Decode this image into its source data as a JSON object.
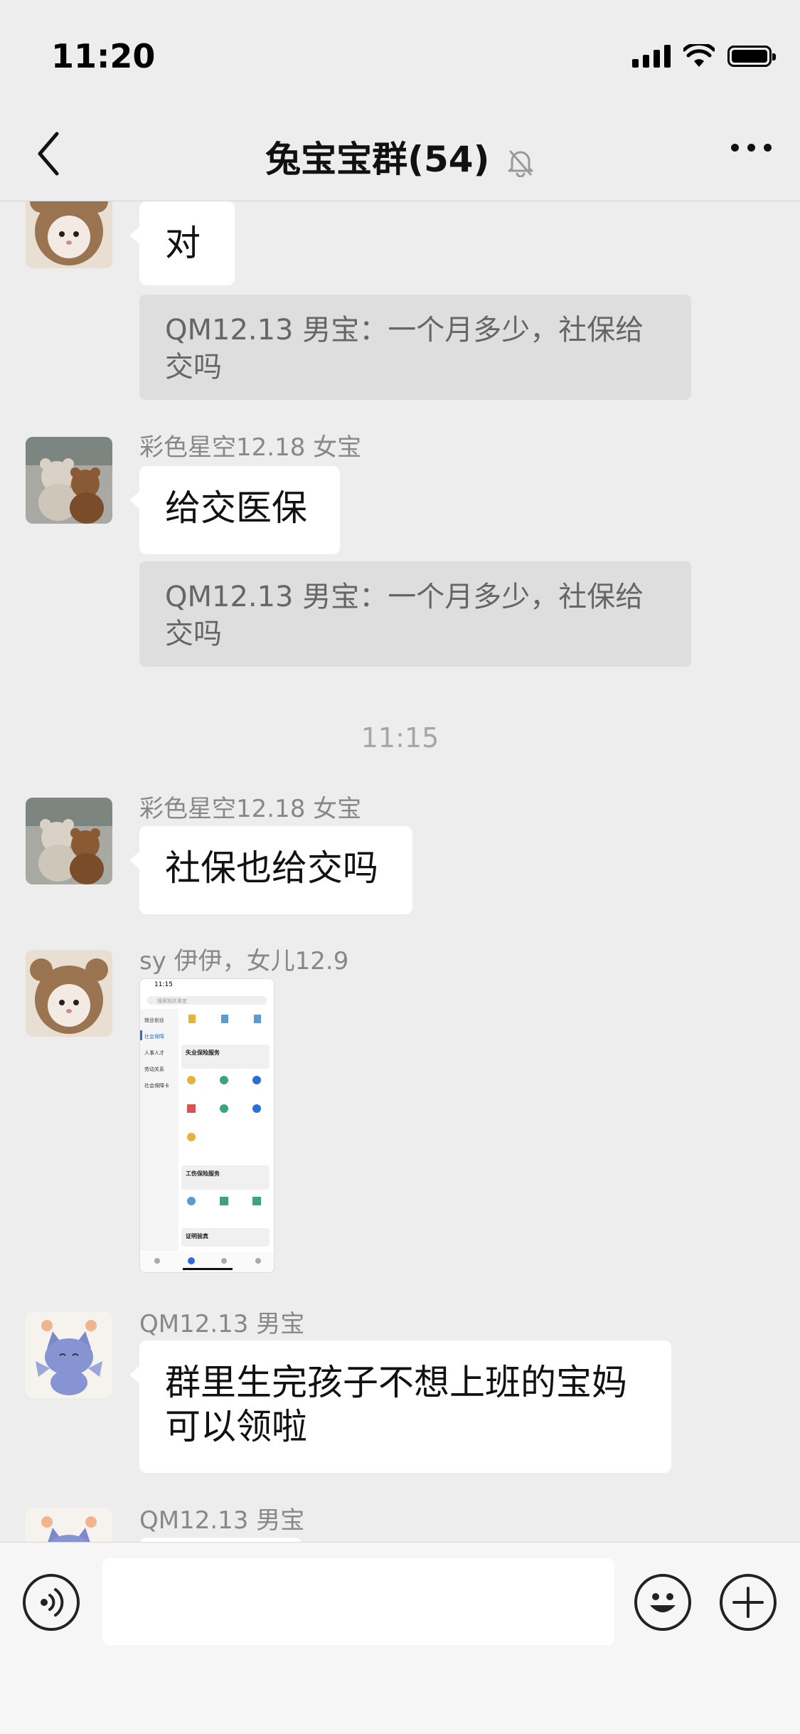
{
  "status_bar": {
    "time": "11:20"
  },
  "nav": {
    "title": "兔宝宝群(54)"
  },
  "messages": [
    {
      "bubble": "对",
      "quote": "QM12.13 男宝：一个月多少，社保给交吗"
    },
    {
      "sender": "彩色星空12.18 女宝",
      "bubble": "给交医保",
      "quote": "QM12.13 男宝：一个月多少，社保给交吗"
    },
    {
      "time": "11:15"
    },
    {
      "sender": "彩色星空12.18 女宝",
      "bubble": "社保也给交吗"
    },
    {
      "sender": "sy 伊伊，女儿12.9",
      "image": "screenshot-thumbnail"
    },
    {
      "sender": "QM12.13 男宝",
      "bubble_lines": [
        "群里生完孩子不想上班的宝妈",
        "可以领啦"
      ]
    },
    {
      "sender": "QM12.13 男宝"
    }
  ],
  "thumbnail": {
    "time": "11:15",
    "search": "搜索相关事宜",
    "sidebar": [
      "就业创业",
      "社会保障",
      "人事人才",
      "劳动关系",
      "社会保障卡"
    ],
    "section1": "失业保险服务",
    "section2": "工伤保险服务",
    "section3": "证明验真"
  },
  "colors": {
    "background": "#ededed",
    "bubble": "#ffffff",
    "quote": "#dedede",
    "meta_text": "#888888"
  }
}
